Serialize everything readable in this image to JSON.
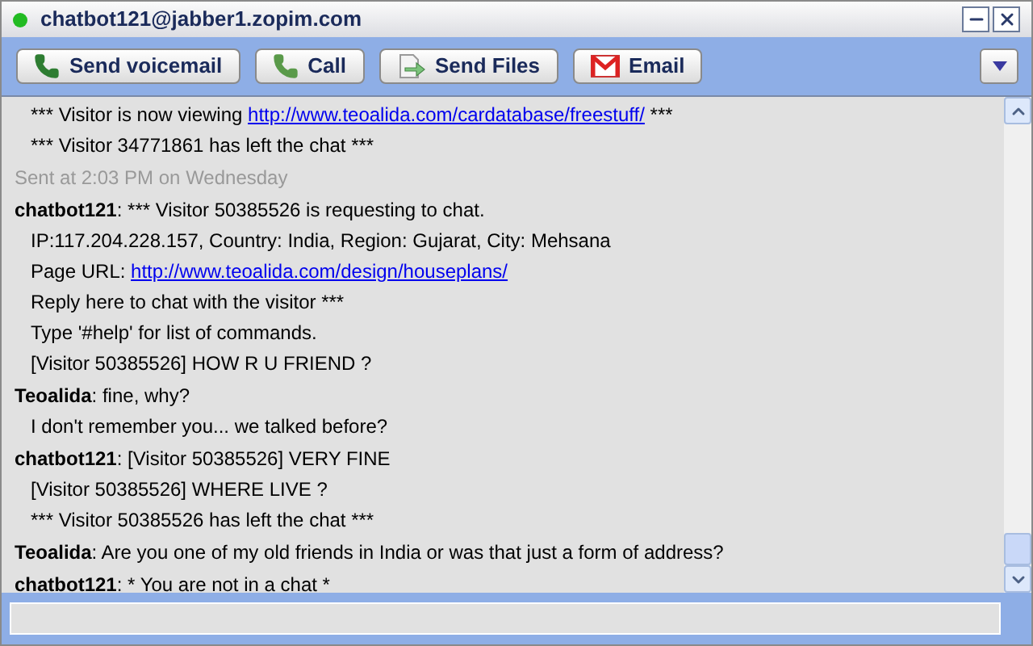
{
  "window": {
    "title": "chatbot121@jabber1.zopim.com"
  },
  "toolbar": {
    "buttons": [
      {
        "label": "Send voicemail",
        "kind": "voicemail"
      },
      {
        "label": "Call",
        "kind": "call"
      },
      {
        "label": "Send Files",
        "kind": "files"
      },
      {
        "label": "Email",
        "kind": "email"
      }
    ]
  },
  "chat": {
    "blocks": [
      {
        "kind": "continuation",
        "lines": [
          [
            {
              "text": "*** Visitor is now viewing "
            },
            {
              "text": "http://www.teoalida.com/cardatabase/freestuff/",
              "kind": "link"
            },
            {
              "text": " ***"
            }
          ],
          [
            {
              "text": "*** Visitor 34771861 has left the chat ***"
            }
          ]
        ]
      },
      {
        "kind": "timestamp",
        "lines": [
          [
            {
              "text": "Sent at 2:03 PM on Wednesday"
            }
          ]
        ]
      },
      {
        "kind": "message",
        "sender": "chatbot121",
        "lines": [
          [
            {
              "text": ": *** Visitor 50385526 is requesting to chat."
            }
          ],
          [
            {
              "text": "IP:117.204.228.157, Country: India, Region: Gujarat, City: Mehsana"
            }
          ],
          [
            {
              "text": "Page URL: "
            },
            {
              "text": "http://www.teoalida.com/design/houseplans/",
              "kind": "link"
            }
          ],
          [
            {
              "text": "Reply here to chat with the visitor ***"
            }
          ],
          [
            {
              "text": "Type '#help' for list of commands."
            }
          ],
          [
            {
              "text": "[Visitor 50385526] HOW R U FRIEND ?"
            }
          ]
        ]
      },
      {
        "kind": "message",
        "sender": "Teoalida",
        "lines": [
          [
            {
              "text": ": fine, why?"
            }
          ],
          [
            {
              "text": "I don't remember you... we talked before?"
            }
          ]
        ]
      },
      {
        "kind": "message",
        "sender": "chatbot121",
        "lines": [
          [
            {
              "text": ": [Visitor 50385526] VERY FINE"
            }
          ],
          [
            {
              "text": "[Visitor 50385526] WHERE LIVE ?"
            }
          ],
          [
            {
              "text": "*** Visitor 50385526 has left the chat ***"
            }
          ]
        ]
      },
      {
        "kind": "message",
        "sender": "Teoalida",
        "lines": [
          [
            {
              "text": ": Are you one of my old friends in India or was that just a form of address?"
            }
          ]
        ]
      },
      {
        "kind": "message",
        "sender": "chatbot121",
        "lines": [
          [
            {
              "text": ": * You are not in a chat *"
            }
          ]
        ]
      }
    ]
  }
}
